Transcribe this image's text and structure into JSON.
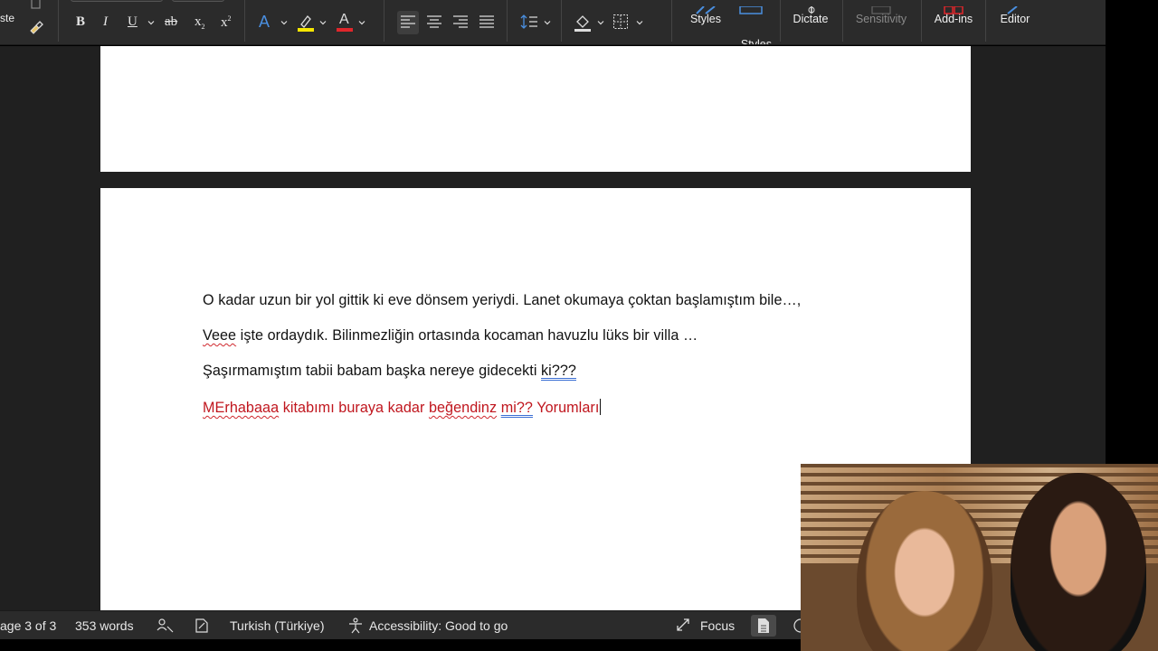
{
  "ribbon": {
    "paste_label": "ste",
    "styles_label": "Styles",
    "styles_pane_label": "Styles\nPane",
    "dictate_label": "Dictate",
    "sensitivity_label": "Sensitivity",
    "addins_label": "Add-ins",
    "editor_label": "Editor",
    "bold": "B",
    "italic": "I",
    "underline": "U",
    "strikethrough": "ab",
    "subscript": "x",
    "superscript": "x",
    "sub_mark": "2",
    "sup_mark": "2",
    "font_color_glyph": "A",
    "text_effect_glyph": "A",
    "colors": {
      "highlight": "#f5e600",
      "font_color": "#e0262b",
      "text_effect": "#4a8fe0",
      "accent": "#4a8fe0"
    }
  },
  "document": {
    "paragraphs": [
      {
        "text": "O kadar uzun bir yol gittik ki eve dönsem yeriydi. Lanet okumaya çoktan başlamıştım bile…,"
      },
      {
        "spell": "Veee",
        "rest": " işte ordaydık. Bilinmezliğin ortasında kocaman havuzlu lüks bir villa …"
      },
      {
        "lead": "Şaşırmamıştım tabii babam başka nereye gidecekti ",
        "gram": "ki???"
      },
      {
        "spell1": "MErhabaaa",
        "mid1": " kitabımı buraya kadar ",
        "spell2": "beğendinz",
        "mid2": " ",
        "gram": "mi??",
        "tail": " Yorumları"
      }
    ],
    "text_colors": {
      "normal": "#111111",
      "red": "#c0161e"
    }
  },
  "status_bar": {
    "page": "age 3 of 3",
    "words": "353 words",
    "language": "Turkish (Türkiye)",
    "accessibility": "Accessibility: Good to go",
    "focus": "Focus"
  }
}
